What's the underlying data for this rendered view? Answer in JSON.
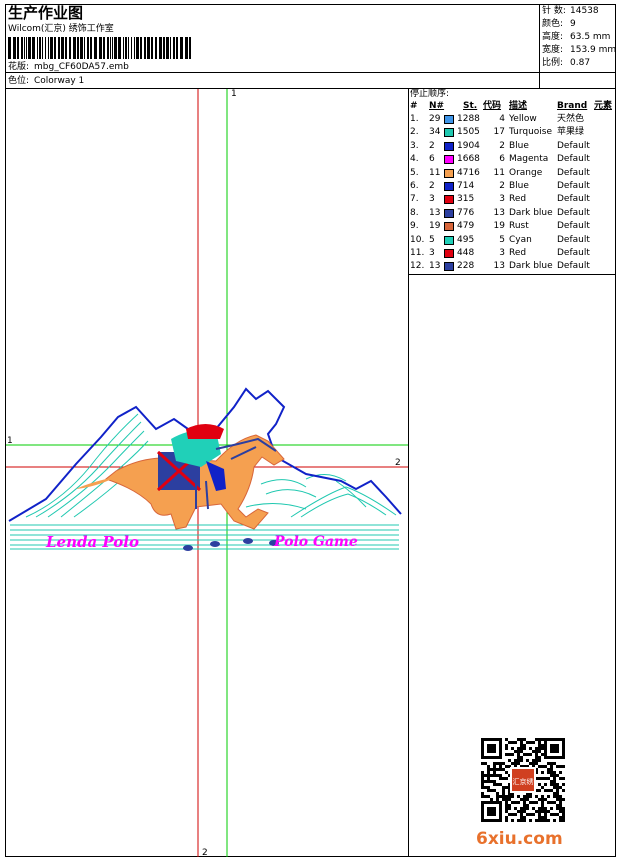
{
  "header": {
    "title": "生产作业图",
    "company": "Wilcom(汇京) 绣饰工作室",
    "design_label": "花版:",
    "design_value": "mbg_CF60DA57.emb",
    "colorway_label": "色位:",
    "colorway_value": "Colorway 1"
  },
  "info": {
    "stitches_label": "针 数:",
    "stitches_value": "14538",
    "colors_label": "颜色:",
    "colors_value": "9",
    "height_label": "高度:",
    "height_value": "63.5 mm",
    "width_label": "宽度:",
    "width_value": "153.9 mm",
    "scale_label": "比例:",
    "scale_value": "0.87"
  },
  "stop_sequence": {
    "title": "停止顺序:",
    "columns": [
      "#",
      "N#",
      "St.",
      "代码",
      "描述",
      "Brand",
      "元素"
    ],
    "rows": [
      {
        "idx": "1.",
        "n": "29",
        "color": "#3f95e8",
        "st": "1288",
        "code": "4",
        "desc": "Yellow",
        "brand": "天然色"
      },
      {
        "idx": "2.",
        "n": "34",
        "color": "#1fc8b0",
        "st": "1505",
        "code": "17",
        "desc": "Turquoise",
        "brand": "苹果绿"
      },
      {
        "idx": "3.",
        "n": "2",
        "color": "#1022c8",
        "st": "1904",
        "code": "2",
        "desc": "Blue",
        "brand": "Default"
      },
      {
        "idx": "4.",
        "n": "6",
        "color": "#ff00ff",
        "st": "1668",
        "code": "6",
        "desc": "Magenta",
        "brand": "Default"
      },
      {
        "idx": "5.",
        "n": "11",
        "color": "#f5a050",
        "st": "4716",
        "code": "11",
        "desc": "Orange",
        "brand": "Default"
      },
      {
        "idx": "6.",
        "n": "2",
        "color": "#1022c8",
        "st": "714",
        "code": "2",
        "desc": "Blue",
        "brand": "Default"
      },
      {
        "idx": "7.",
        "n": "3",
        "color": "#e00010",
        "st": "315",
        "code": "3",
        "desc": "Red",
        "brand": "Default"
      },
      {
        "idx": "8.",
        "n": "13",
        "color": "#2c3fa0",
        "st": "776",
        "code": "13",
        "desc": "Dark blue",
        "brand": "Default"
      },
      {
        "idx": "9.",
        "n": "19",
        "color": "#d8663a",
        "st": "479",
        "code": "19",
        "desc": "Rust",
        "brand": "Default"
      },
      {
        "idx": "10.",
        "n": "5",
        "color": "#20d0b8",
        "st": "495",
        "code": "5",
        "desc": "Cyan",
        "brand": "Default"
      },
      {
        "idx": "11.",
        "n": "3",
        "color": "#e00010",
        "st": "448",
        "code": "3",
        "desc": "Red",
        "brand": "Default"
      },
      {
        "idx": "12.",
        "n": "13",
        "color": "#2c3fa0",
        "st": "228",
        "code": "13",
        "desc": "Dark blue",
        "brand": "Default"
      }
    ]
  },
  "design": {
    "text_left": "Lenda Polo",
    "text_right": "Polo Game",
    "guide_labels": {
      "v_green": "1",
      "h_green": "1",
      "h_red": "2",
      "v_red": "2"
    },
    "colors": {
      "mountain": "#1022c8",
      "lines": "#20c8b0",
      "horse": "#f5a050",
      "text": "#ff00ff",
      "guide_green": "#00cc00",
      "guide_red": "#d00000"
    }
  },
  "watermark": {
    "site": "6xiu.com",
    "seal_text": "汇京绣"
  }
}
